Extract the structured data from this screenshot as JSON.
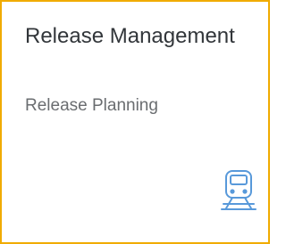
{
  "tile": {
    "title": "Release Management",
    "subtitle": "Release Planning",
    "icon": "train-icon",
    "colors": {
      "border": "#f0ab00",
      "title": "#32363a",
      "subtitle": "#6a6d70",
      "icon": "#5899da"
    }
  }
}
